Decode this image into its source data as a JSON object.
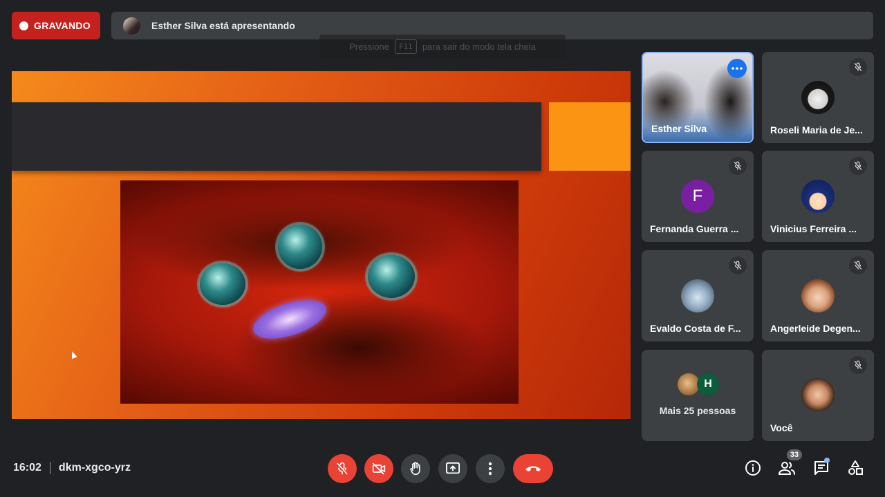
{
  "recording": {
    "label": "GRAVANDO"
  },
  "presentation": {
    "banner": "Esther Silva está apresentando"
  },
  "fullscreen_hint": {
    "prefix": "Pressione",
    "key": "F11",
    "suffix": "para sair do modo tela cheia"
  },
  "participants": [
    {
      "name": "Esther Silva",
      "type": "video",
      "active": true
    },
    {
      "name": "Roseli Maria de Je...",
      "type": "photo",
      "muted": true
    },
    {
      "name": "Fernanda Guerra ...",
      "type": "letter",
      "letter": "F",
      "color": "#7b1fa2",
      "muted": true
    },
    {
      "name": "Vinicius Ferreira ...",
      "type": "photo",
      "muted": true
    },
    {
      "name": "Evaldo Costa de F...",
      "type": "photo",
      "muted": true
    },
    {
      "name": "Angerleide Degen...",
      "type": "photo",
      "muted": true
    },
    {
      "name": "Você",
      "type": "photo",
      "muted": true
    }
  ],
  "more_people": {
    "label": "Mais 25 pessoas",
    "letter": "H",
    "letter_color": "#0b5d3b"
  },
  "footer": {
    "time": "16:02",
    "meeting_code": "dkm-xgco-yrz",
    "people_count": "33"
  },
  "colors": {
    "accent_blue": "#8ab4f8",
    "danger_red": "#ea4335",
    "recording_red": "#c5221f"
  }
}
